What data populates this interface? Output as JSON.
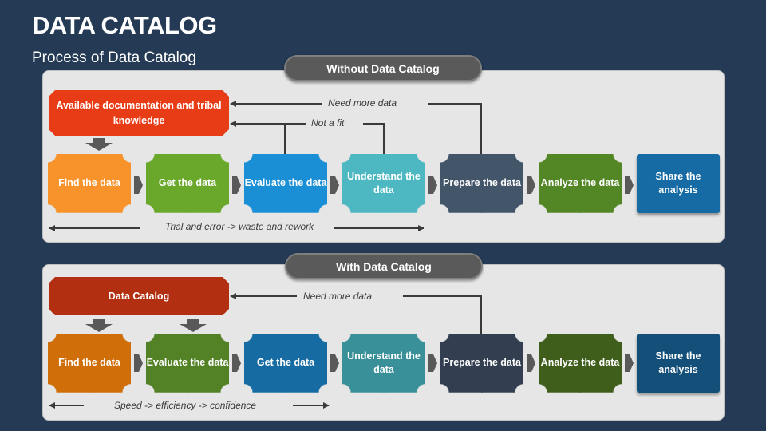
{
  "header": {
    "title": "DATA CATALOG",
    "subtitle": "Process of Data Catalog"
  },
  "without": {
    "label": "Without Data Catalog",
    "source": "Available documentation and tribal knowledge",
    "source_color": "#e83c17",
    "steps": [
      {
        "label": "Find the data",
        "color": "#f7932a"
      },
      {
        "label": "Get the data",
        "color": "#6aa82b"
      },
      {
        "label": "Evaluate the data",
        "color": "#1b8fd6"
      },
      {
        "label": "Understand the data",
        "color": "#4db8c2"
      },
      {
        "label": "Prepare the data",
        "color": "#435569"
      },
      {
        "label": "Analyze the data",
        "color": "#538625"
      },
      {
        "label": "Share the analysis",
        "color": "#176ba4"
      }
    ],
    "feedback": [
      "Need more data",
      "Not a fit"
    ],
    "footer": "Trial and error -> waste and rework"
  },
  "with": {
    "label": "With Data Catalog",
    "source": "Data Catalog",
    "source_color": "#b32f12",
    "steps": [
      {
        "label": "Find the data",
        "color": "#d06f0a"
      },
      {
        "label": "Evaluate the data",
        "color": "#538125"
      },
      {
        "label": "Get the data",
        "color": "#166ba2"
      },
      {
        "label": "Understand the data",
        "color": "#3a9099"
      },
      {
        "label": "Prepare the data",
        "color": "#333f50"
      },
      {
        "label": "Analyze the data",
        "color": "#3f5e1b"
      },
      {
        "label": "Share the analysis",
        "color": "#134f78"
      }
    ],
    "feedback": [
      "Need more data"
    ],
    "footer": "Speed -> efficiency -> confidence"
  }
}
